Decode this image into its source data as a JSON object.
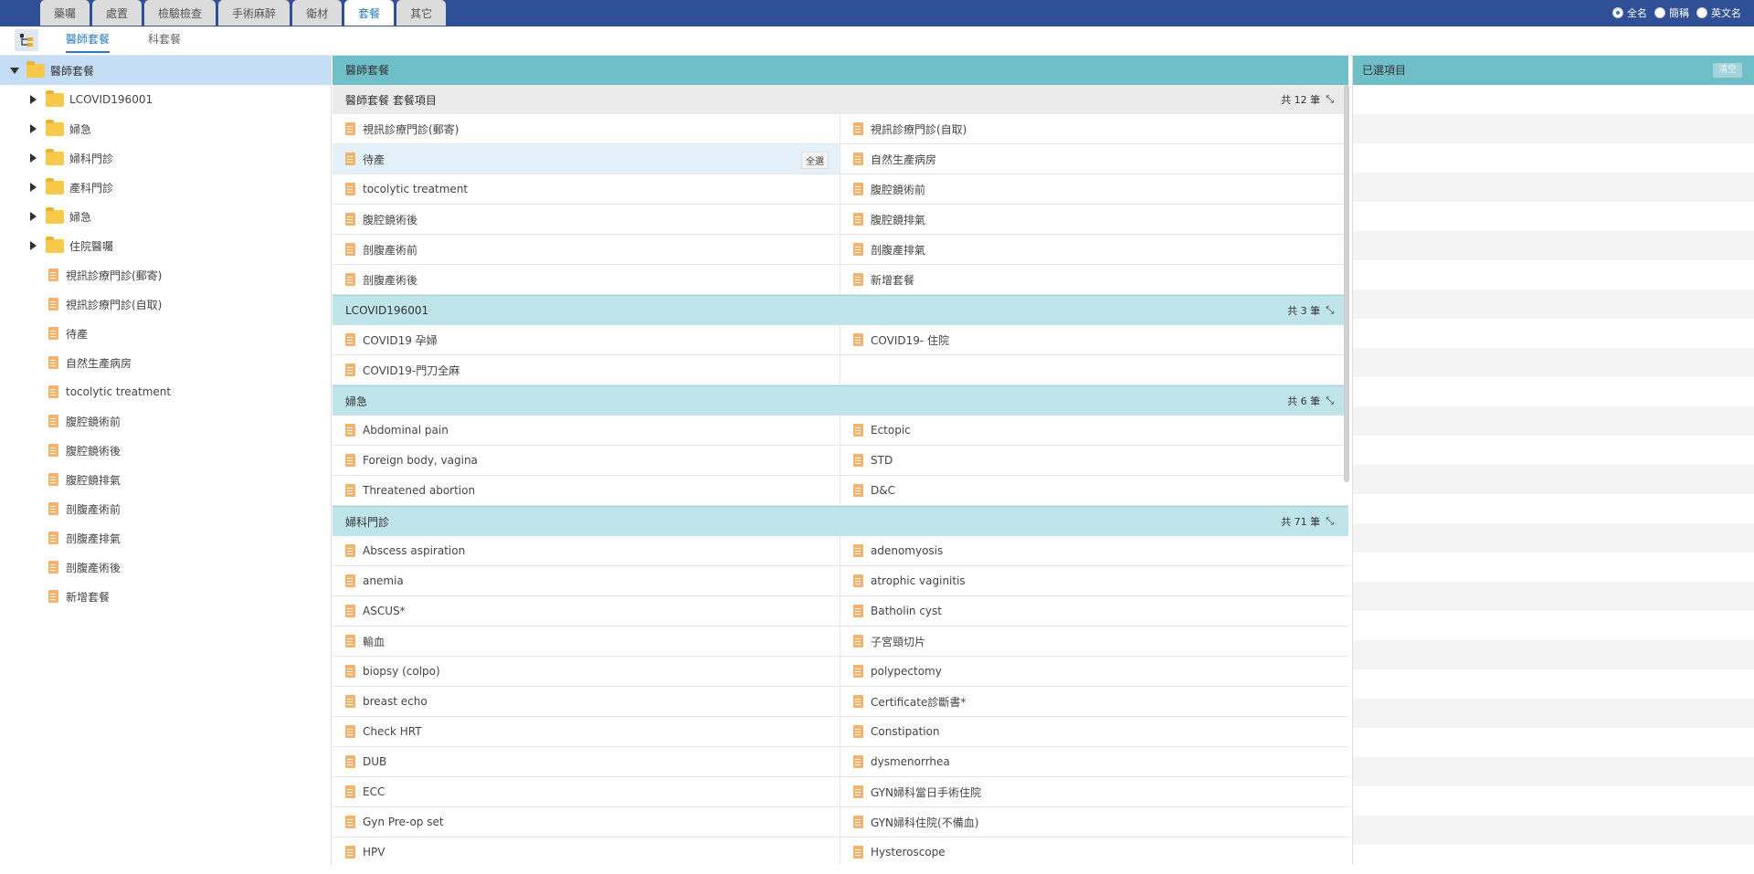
{
  "top_tabs": [
    "藥囑",
    "處置",
    "檢驗檢查",
    "手術麻醉",
    "衛材",
    "套餐",
    "其它"
  ],
  "active_top_tab": 5,
  "name_options": [
    "全名",
    "簡稱",
    "英文名"
  ],
  "sub_tabs": [
    "醫師套餐",
    "科套餐"
  ],
  "tree": {
    "root": "醫師套餐",
    "folders": [
      "LCOVID196001",
      "婦急",
      "婦科門診",
      "產科門診",
      "婦急",
      "住院醫囑"
    ],
    "items": [
      "視訊診療門診(郵寄)",
      "視訊診療門診(自取)",
      "待產",
      "自然生產病房",
      "tocolytic treatment",
      "腹腔鏡術前",
      "腹腔鏡術後",
      "腹腔鏡排氣",
      "剖腹產術前",
      "剖腹產排氣",
      "剖腹產術後",
      "新增套餐"
    ]
  },
  "middle": {
    "title": "醫師套餐",
    "select_all_label": "全選",
    "groups": [
      {
        "name": "醫師套餐 套餐項目",
        "count": "共 12 筆",
        "items": [
          "視訊診療門診(郵寄)",
          "視訊診療門診(自取)",
          "待產",
          "自然生產病房",
          "tocolytic treatment",
          "腹腔鏡術前",
          "腹腔鏡術後",
          "腹腔鏡排氣",
          "剖腹產術前",
          "剖腹產排氣",
          "剖腹產術後",
          "新增套餐"
        ]
      },
      {
        "name": "LCOVID196001",
        "count": "共 3 筆",
        "items": [
          "COVID19 孕婦",
          "COVID19- 住院",
          "COVID19-門刀全麻"
        ]
      },
      {
        "name": "婦急",
        "count": "共 6 筆",
        "items": [
          "Abdominal pain",
          "Ectopic",
          "Foreign body, vagina",
          "STD",
          "Threatened abortion",
          "D&C"
        ]
      },
      {
        "name": "婦科門診",
        "count": "共 71 筆",
        "items": [
          "Abscess aspiration",
          "adenomyosis",
          "anemia",
          "atrophic vaginitis",
          "ASCUS*",
          "Batholin cyst",
          "輸血",
          "子宮頸切片",
          "biopsy (colpo)",
          "polypectomy",
          "breast echo",
          "Certificate診斷書*",
          "Check HRT",
          "Constipation",
          "DUB",
          "dysmenorrhea",
          "ECC",
          "GYN婦科當日手術住院",
          "Gyn Pre-op set",
          "GYN婦科住院(不備血)",
          "HPV",
          "Hysteroscope"
        ]
      }
    ]
  },
  "right": {
    "title": "已選項目",
    "clear_label": "清空"
  }
}
